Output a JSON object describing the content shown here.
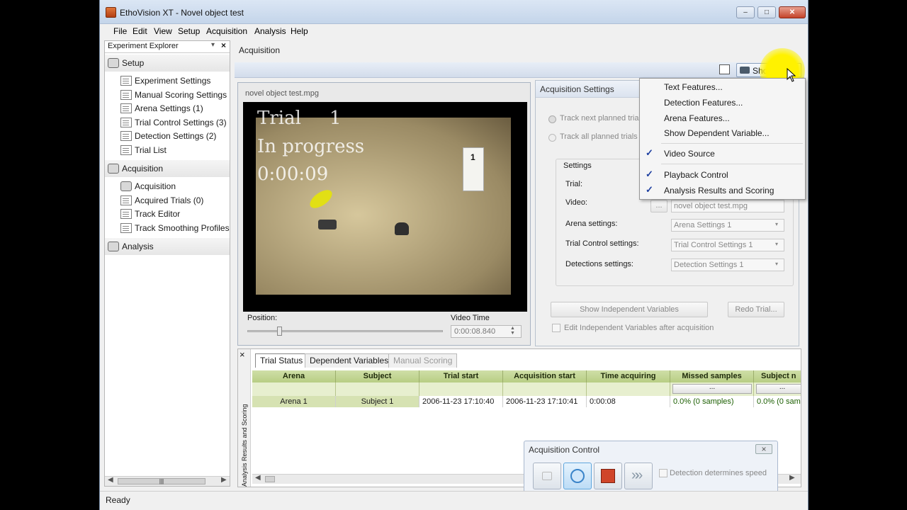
{
  "window": {
    "title": "EthoVision XT - Novel object test"
  },
  "menu": [
    "File",
    "Edit",
    "View",
    "Setup",
    "Acquisition",
    "Analysis",
    "Help"
  ],
  "explorer": {
    "header": "Experiment Explorer",
    "setup": {
      "label": "Setup",
      "items": [
        "Experiment Settings",
        "Manual Scoring Settings",
        "Arena Settings (1)",
        "Trial Control Settings (3)",
        "Detection Settings (2)",
        "Trial List"
      ]
    },
    "acquisition": {
      "label": "Acquisition",
      "items": [
        "Acquisition",
        "Acquired Trials (0)",
        "Track Editor",
        "Track Smoothing Profiles"
      ]
    },
    "analysis": {
      "label": "Analysis"
    }
  },
  "breadcrumb": "Acquisition",
  "toolbar": {
    "show_hide": "Show/Hide"
  },
  "video": {
    "title": "novel object test.mpg",
    "overlay_trial": "Trial",
    "overlay_trial_num": "1",
    "overlay_status": "In progress",
    "overlay_time": "0:00:09",
    "position_label": "Position:",
    "position_value": 0.15,
    "video_time_label": "Video Time",
    "video_time_value": "0:00:08.840",
    "marker_label": "1"
  },
  "acq_settings": {
    "title": "Acquisition Settings",
    "radio1": "Track next planned trial",
    "radio2": "Track all planned trials",
    "settings_group": "Settings",
    "trial_label": "Trial:",
    "video_label": "Video:",
    "video_browse": "...",
    "video_value": "novel object test.mpg",
    "arena_label": "Arena settings:",
    "arena_value": "Arena Settings 1",
    "trial_control_label": "Trial Control settings:",
    "trial_control_value": "Trial Control Settings 1",
    "detection_label": "Detections settings:",
    "detection_value": "Detection Settings 1",
    "show_indep_button": "Show Independent Variables",
    "redo_button": "Redo Trial...",
    "edit_indep_checkbox": "Edit Independent Variables after acquisition"
  },
  "dropdown": {
    "items": [
      {
        "label": "Text Features...",
        "checked": false
      },
      {
        "label": "Detection Features...",
        "checked": false
      },
      {
        "label": "Arena Features...",
        "checked": false
      },
      {
        "label": "Show Dependent Variable...",
        "checked": false
      },
      {
        "label": "Video Source",
        "checked": true
      },
      {
        "label": "Playback Control",
        "checked": true
      },
      {
        "label": "Analysis Results and Scoring",
        "checked": true
      }
    ],
    "check_glyph": "✓"
  },
  "analysis_panel": {
    "side_label": "Analysis Results and Scoring",
    "close_glyph": "×",
    "tabs": [
      "Trial Status",
      "Dependent Variables",
      "Manual Scoring"
    ],
    "columns": [
      "Arena",
      "Subject",
      "Trial start",
      "Acquisition start",
      "Time acquiring",
      "Missed samples",
      "Subject n"
    ],
    "filter_glyph": "...",
    "rows": [
      [
        "Arena 1",
        "Subject 1",
        "2006-11-23 17:10:40",
        "2006-11-23 17:10:41",
        "0:00:08",
        "0.0% (0 samples)",
        "0.0% (0 sam"
      ]
    ]
  },
  "acq_control": {
    "title": "Acquisition Control",
    "close_glyph": "×",
    "checkbox_label": "Detection determines speed"
  },
  "explorer_scroll_glyph": "|||",
  "status_bar": "Ready",
  "colors": {
    "table_header": "#c3d595",
    "table_first_col": "#d6e2b2",
    "green_text": "#1b5e00",
    "stop_button": "#d0452a",
    "cursor_highlight": "#fff200"
  }
}
